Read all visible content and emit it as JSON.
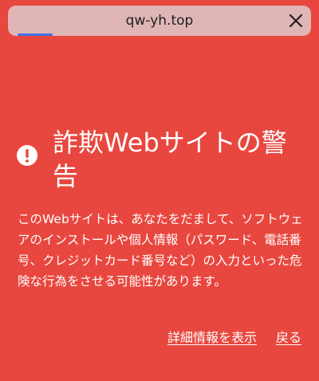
{
  "browser": {
    "url": "qw-yh.top",
    "close_icon": "close-icon",
    "progress_color": "#3f73e3"
  },
  "warning": {
    "icon": "exclamation-circle-icon",
    "title": "詐欺Webサイトの警告",
    "body": "このWebサイトは、あなたをだまして、ソフトウェアのインストールや個人情報（パスワード、電話番号、クレジットカード番号など）の入力といった危険な行為をさせる可能性があります。",
    "details_link": "詳細情報を表示",
    "back_link": "戻る",
    "background_color": "#e8473f"
  }
}
